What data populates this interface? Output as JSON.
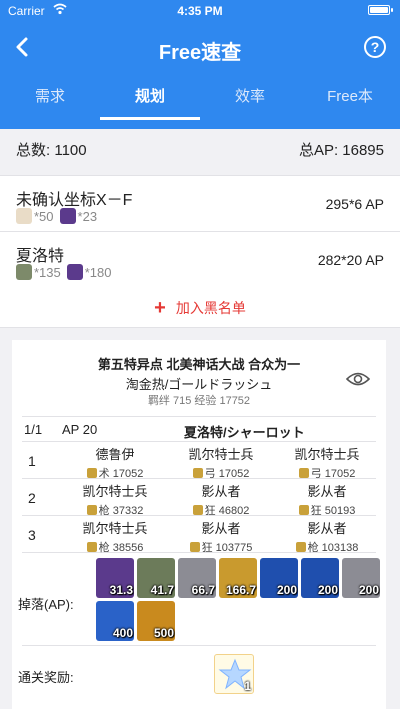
{
  "status": {
    "carrier": "Carrier",
    "time": "4:35 PM"
  },
  "nav": {
    "title": "Free速查"
  },
  "tabs": [
    {
      "label": "需求"
    },
    {
      "label": "规划",
      "active": true
    },
    {
      "label": "效率"
    },
    {
      "label": "Free本"
    }
  ],
  "summary": {
    "total": "总数: 1100",
    "total_ap": "总AP: 16895"
  },
  "items": [
    {
      "name": "未确认坐标X－F",
      "ap": "295*6 AP",
      "mats": [
        {
          "count": "*50",
          "icon": "feather-icon"
        },
        {
          "count": "*23",
          "icon": "purple-crystal-icon"
        }
      ]
    },
    {
      "name": "夏洛特",
      "ap": "282*20 AP",
      "mats": [
        {
          "count": "*135",
          "icon": "green-ring-icon"
        },
        {
          "count": "*180",
          "icon": "purple-crystal-icon"
        }
      ]
    }
  ],
  "blacklist": {
    "label": "加入黑名单"
  },
  "quest": {
    "title": "第五特异点 北美神话大战 合众为一",
    "subtitle": "淘金热/ゴールドラッシュ",
    "bond_exp": "羁绊 715  经验 17752",
    "header": {
      "index": "1/1",
      "ap": "AP 20",
      "location": "夏洛特/シャーロット"
    },
    "waves": [
      {
        "num": "1",
        "enemies": [
          {
            "name": "德鲁伊",
            "info": "术 17052"
          },
          {
            "name": "凯尔特士兵",
            "info": "弓 17052"
          },
          {
            "name": "凯尔特士兵",
            "info": "弓 17052"
          }
        ]
      },
      {
        "num": "2",
        "enemies": [
          {
            "name": "凯尔特士兵",
            "info": "枪 37332"
          },
          {
            "name": "影从者",
            "info": "狂 46802"
          },
          {
            "name": "影从者",
            "info": "狂 50193"
          }
        ]
      },
      {
        "num": "3",
        "enemies": [
          {
            "name": "凯尔特士兵",
            "info": "枪 38556"
          },
          {
            "name": "影从者",
            "info": "狂 103775"
          },
          {
            "name": "影从者",
            "info": "枪 103138"
          }
        ]
      }
    ],
    "drops_label": "掉落(AP):",
    "drops": [
      {
        "value": "31.3",
        "icon": "purple-crystal-icon",
        "color": "#5b3a8c"
      },
      {
        "value": "41.7",
        "icon": "green-ring-icon",
        "color": "#6c7b5a"
      },
      {
        "value": "66.7",
        "icon": "silver-piece-icon",
        "color": "#8c8c94"
      },
      {
        "value": "166.7",
        "icon": "gold-piece-icon",
        "color": "#c99a2e"
      },
      {
        "value": "200",
        "icon": "blue-gem-icon",
        "color": "#1f4fae"
      },
      {
        "value": "200",
        "icon": "blue-gem-icon",
        "color": "#1f4fae"
      },
      {
        "value": "200",
        "icon": "silver-piece-icon",
        "color": "#8c8c94"
      },
      {
        "value": "400",
        "icon": "blue-gem-icon",
        "color": "#2a62c8"
      },
      {
        "value": "500",
        "icon": "gold-gem-icon",
        "color": "#c98a1e"
      }
    ],
    "reward_label": "通关奖励:",
    "reward": {
      "value": "1",
      "icon": "saint-quartz-icon"
    }
  },
  "colors": {
    "primary": "#2f88ef",
    "accent_red": "#e53935"
  }
}
